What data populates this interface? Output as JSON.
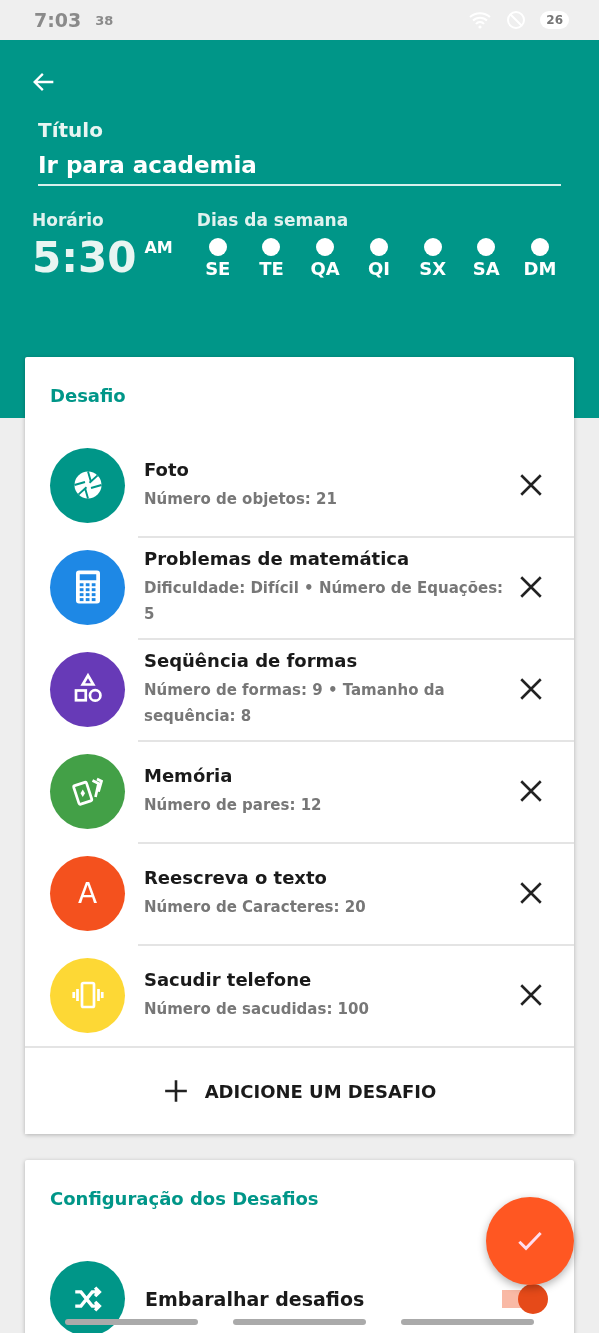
{
  "status_bar": {
    "time": "7:03",
    "notification_count": "38",
    "battery": "26"
  },
  "header": {
    "title_label": "Título",
    "title_value": "Ir para academia",
    "time_label": "Horário",
    "time": "5:30",
    "period": "AM",
    "days_label": "Dias da semana",
    "days": [
      {
        "label": "SE",
        "selected": false
      },
      {
        "label": "TE",
        "selected": false
      },
      {
        "label": "QA",
        "selected": false
      },
      {
        "label": "QI",
        "selected": false
      },
      {
        "label": "SX",
        "selected": false
      },
      {
        "label": "SA",
        "selected": false
      },
      {
        "label": "DM",
        "selected": false
      }
    ]
  },
  "challenges": {
    "title": "Desafio",
    "items": [
      {
        "kind": "photo",
        "color": "#009688",
        "name": "Foto",
        "detail": "Número de objetos: 21"
      },
      {
        "kind": "math",
        "color": "#1e88e5",
        "name": "Problemas de matemática",
        "detail": "Dificuldade: Difícil • Número de Equações: 5"
      },
      {
        "kind": "shapes",
        "color": "#673ab7",
        "name": "Seqüência de formas",
        "detail": "Número de formas: 9 • Tamanho da sequência: 8"
      },
      {
        "kind": "memory",
        "color": "#43a047",
        "name": "Memória",
        "detail": "Número de pares: 12"
      },
      {
        "kind": "text",
        "color": "#f4511e",
        "name": "Reescreva o texto",
        "detail": "Número de Caracteres: 20",
        "letter": "A"
      },
      {
        "kind": "shake",
        "color": "#fdd835",
        "name": "Sacudir telefone",
        "detail": "Número de sacudidas: 100"
      }
    ],
    "add_button": "ADICIONE UM DESAFIO"
  },
  "settings": {
    "title": "Configuração dos Desafios",
    "items": [
      {
        "label": "Embaralhar desafios",
        "on": true
      }
    ]
  }
}
